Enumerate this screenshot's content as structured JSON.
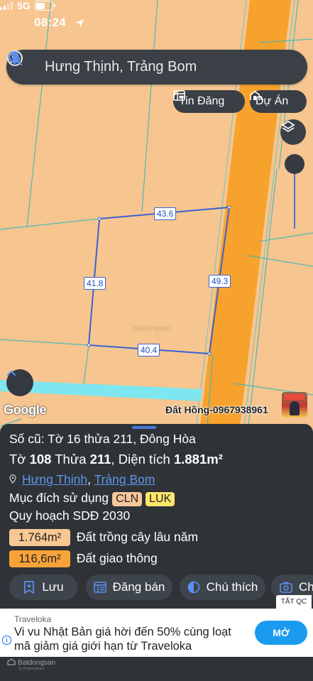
{
  "status": {
    "time": "08:24",
    "network": "5G"
  },
  "search": {
    "text": "Hưng Thịnh, Trảng Bom"
  },
  "chips": {
    "listing": "Tin Đăng",
    "project": "Dự Án"
  },
  "map": {
    "measurements": {
      "top": "43.6",
      "left": "41.8",
      "right": "49.3",
      "bottom": "40.4"
    },
    "google": "Google",
    "watermark": "Batdongsan",
    "owner": "Đất Hồng-0967938961"
  },
  "panel": {
    "old_ref": "Số cũ: Tờ 16 thửa 211, Đông Hòa",
    "sheet_label": "Tờ ",
    "sheet": "108",
    "parcel_label": " Thửa ",
    "parcel": "211",
    "area_label": ", Diện tích ",
    "area": "1.881m²",
    "location": {
      "ward": "Hưng Thịnh",
      "sep": ", ",
      "district": "Trảng Bom"
    },
    "purpose_label": "Mục đích sử dụng",
    "purpose_tags": [
      {
        "code": "CLN",
        "color": "#f7c79a"
      },
      {
        "code": "LUK",
        "color": "#ffe66b"
      }
    ],
    "planning": "Quy hoạch SDĐ 2030",
    "zones": [
      {
        "area": "1.764m²",
        "label": "Đất trồng cây lâu năm",
        "color": "#f8c792"
      },
      {
        "area": "116,6m²",
        "label": "Đất giao thông",
        "color": "#f7a33a"
      }
    ],
    "actions": {
      "save": "Lưu",
      "post": "Đăng bán",
      "legend": "Chú thích",
      "capture": "Ch"
    },
    "hide_ads": "TẮT QC"
  },
  "ad": {
    "brand": "Traveloka",
    "text": "Vi vu Nhật Bản giá hời đến 50% cùng loạt mã giảm giá giới hạn từ Traveloka",
    "cta": "MỞ"
  },
  "footer": {
    "brand": "Batdongsan",
    "sub": "by PropertyGuru"
  }
}
